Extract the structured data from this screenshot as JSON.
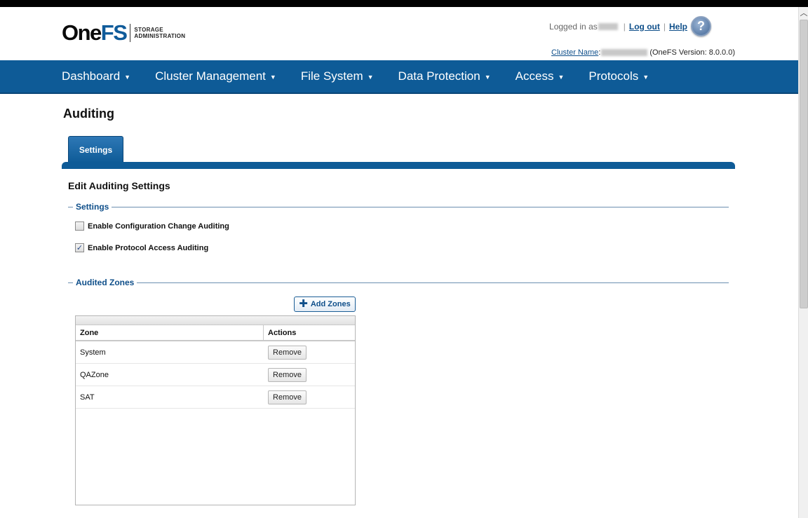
{
  "header": {
    "logo": {
      "one": "One",
      "fs": "FS",
      "sub_line1": "STORAGE",
      "sub_line2": "ADMINISTRATION"
    },
    "logged_in_label": "Logged in as",
    "logout_label": "Log out",
    "help_label": "Help",
    "help_icon": "question-mark-icon",
    "cluster_name_label": "Cluster Name",
    "cluster_version": "(OneFS Version: 8.0.0.0)"
  },
  "nav": {
    "items": [
      {
        "label": "Dashboard"
      },
      {
        "label": "Cluster Management"
      },
      {
        "label": "File System"
      },
      {
        "label": "Data Protection"
      },
      {
        "label": "Access"
      },
      {
        "label": "Protocols"
      }
    ]
  },
  "page": {
    "title": "Auditing",
    "tabs": [
      {
        "label": "Settings",
        "active": true
      }
    ],
    "section_title": "Edit Auditing Settings"
  },
  "settings": {
    "legend": "Settings",
    "options": [
      {
        "label": "Enable Configuration Change Auditing",
        "checked": false
      },
      {
        "label": "Enable Protocol Access Auditing",
        "checked": true
      }
    ]
  },
  "zones": {
    "legend": "Audited Zones",
    "add_button": "Add Zones",
    "columns": [
      "Zone",
      "Actions"
    ],
    "rows": [
      {
        "zone": "System",
        "action": "Remove"
      },
      {
        "zone": "QAZone",
        "action": "Remove"
      },
      {
        "zone": "SAT",
        "action": "Remove"
      }
    ]
  },
  "colors": {
    "brand_blue": "#0e5b97",
    "link_blue": "#0f4f8a"
  }
}
